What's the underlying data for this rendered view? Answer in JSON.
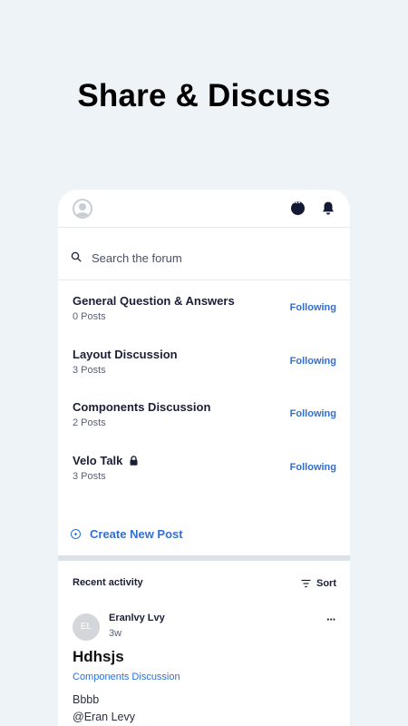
{
  "headline": "Share & Discuss",
  "topbar": {
    "icons": [
      "avatar-placeholder-icon",
      "chat-icon",
      "bell-icon"
    ]
  },
  "search": {
    "placeholder": "Search the forum"
  },
  "categories": [
    {
      "title": "General Question & Answers",
      "count": "0 Posts",
      "action": "Following",
      "locked": false
    },
    {
      "title": "Layout Discussion",
      "count": "3 Posts",
      "action": "Following",
      "locked": false
    },
    {
      "title": "Components Discussion",
      "count": "2 Posts",
      "action": "Following",
      "locked": false
    },
    {
      "title": "Velo Talk",
      "count": "3 Posts",
      "action": "Following",
      "locked": true
    }
  ],
  "create_post": {
    "label": "Create New Post"
  },
  "recent": {
    "title": "Recent activity",
    "sort_label": "Sort",
    "post": {
      "initials": "EL",
      "author": "Eranlvy Lvy",
      "time": "3w",
      "title": "Hdhsjs",
      "category": "Components Discussion",
      "body_lines": [
        "Bbbb",
        "@Eran Levy"
      ]
    }
  },
  "colors": {
    "accent": "#2f6fd6",
    "page_bg": "#eef3f8",
    "text": "#1a1f36"
  }
}
